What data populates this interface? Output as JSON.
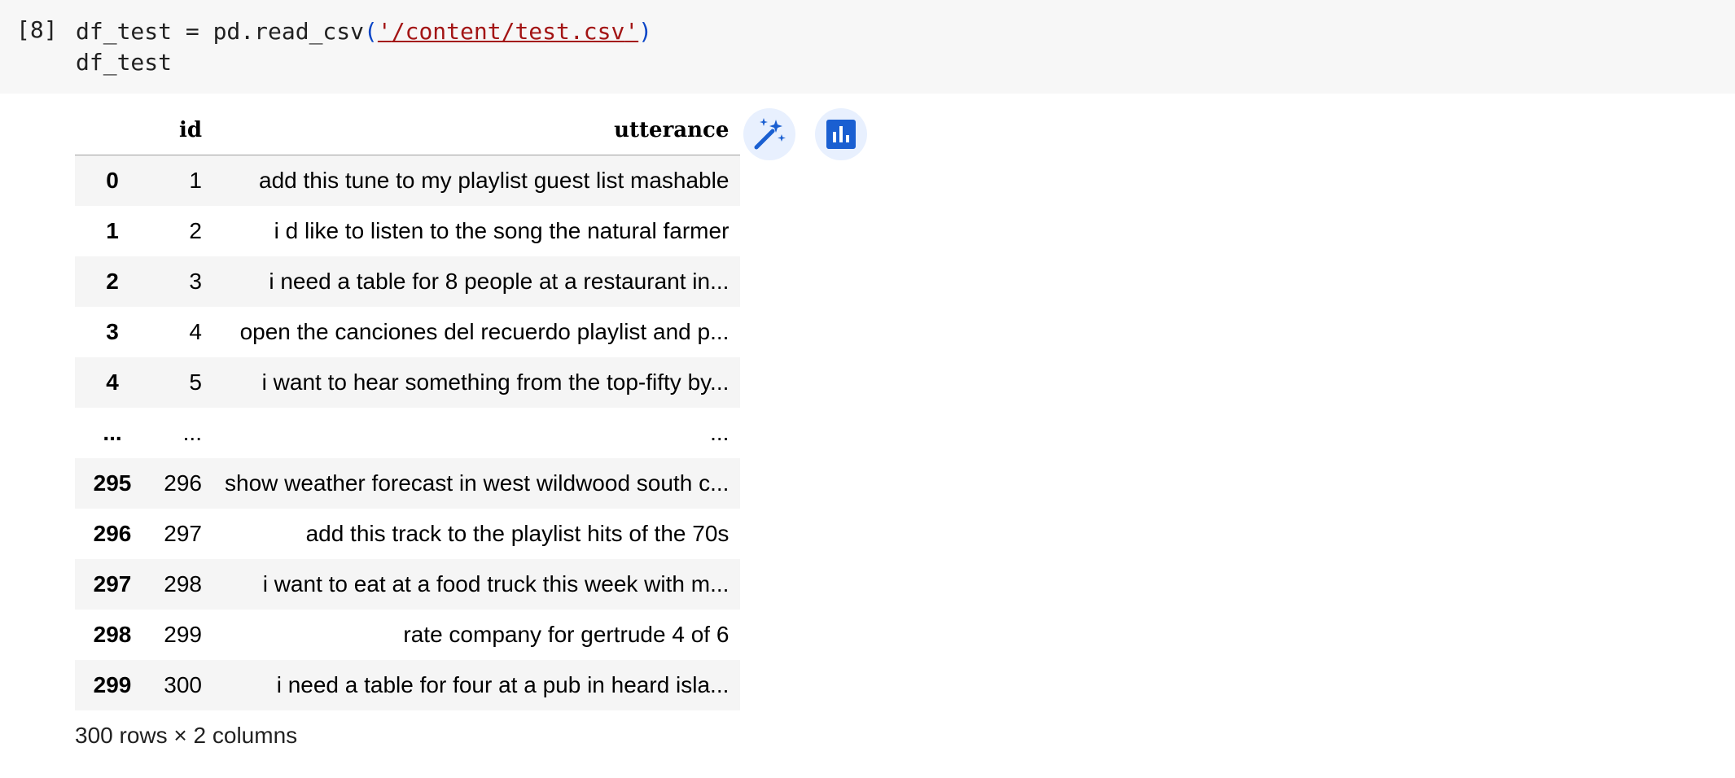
{
  "cell": {
    "exec_count": "[8]",
    "code_line1_prefix": "df_test = pd.read_csv",
    "code_open": "(",
    "code_quote_open": "'",
    "code_path": "/content/test.csv",
    "code_quote_close": "'",
    "code_close": ")",
    "code_line2": "df_test"
  },
  "table": {
    "columns": [
      "",
      "id",
      "utterance"
    ],
    "rows": [
      {
        "index": "0",
        "id": "1",
        "utterance": "add this tune to my playlist guest list mashable"
      },
      {
        "index": "1",
        "id": "2",
        "utterance": "i d like to listen to the song the natural farmer"
      },
      {
        "index": "2",
        "id": "3",
        "utterance": "i need a table for 8 people at a restaurant in..."
      },
      {
        "index": "3",
        "id": "4",
        "utterance": "open the canciones del recuerdo playlist and p..."
      },
      {
        "index": "4",
        "id": "5",
        "utterance": "i want to hear something from the top-fifty by..."
      },
      {
        "index": "...",
        "id": "...",
        "utterance": "..."
      },
      {
        "index": "295",
        "id": "296",
        "utterance": "show weather forecast in west wildwood south c..."
      },
      {
        "index": "296",
        "id": "297",
        "utterance": "add this track to the playlist hits of the 70s"
      },
      {
        "index": "297",
        "id": "298",
        "utterance": "i want to eat at a food truck this week with m..."
      },
      {
        "index": "298",
        "id": "299",
        "utterance": "rate company for gertrude 4 of 6"
      },
      {
        "index": "299",
        "id": "300",
        "utterance": "i need a table for four at a pub in heard isla..."
      }
    ]
  },
  "footer": "300 rows × 2 columns",
  "icons": {
    "magic": "magic-wand-icon",
    "chart": "bar-chart-icon"
  },
  "colors": {
    "accent": "#1a5fd1",
    "button_bg": "#e8f0fe",
    "code_bg": "#f7f7f7",
    "string": "#a31515",
    "paren": "#0d47c7"
  }
}
